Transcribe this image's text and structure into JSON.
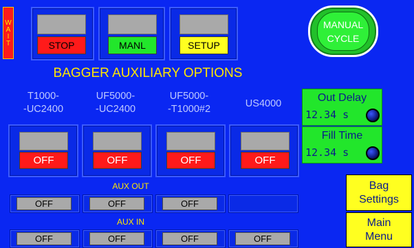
{
  "wait_label": "WAIT",
  "top_buttons": [
    {
      "label": "STOP"
    },
    {
      "label": "MANL"
    },
    {
      "label": "SETUP"
    }
  ],
  "manual_cycle": {
    "line1": "MANUAL",
    "line2": "CYCLE"
  },
  "title": "BAGGER AUXILIARY OPTIONS",
  "columns": [
    {
      "line1": "T1000-",
      "line2": "-UC2400",
      "state": "OFF"
    },
    {
      "line1": "UF5000-",
      "line2": "-UC2400",
      "state": "OFF"
    },
    {
      "line1": "UF5000-",
      "line2": "-T1000#2",
      "state": "OFF"
    },
    {
      "line1": "US4000",
      "line2": "",
      "state": "OFF"
    }
  ],
  "out_delay": {
    "label": "Out Delay",
    "value": "12.34 s"
  },
  "fill_time": {
    "label": "Fill Time",
    "value": "12.34 s"
  },
  "aux_out": {
    "label": "AUX OUT",
    "items": [
      "OFF",
      "OFF",
      "OFF"
    ]
  },
  "aux_in": {
    "label": "AUX IN",
    "items": [
      "OFF",
      "OFF",
      "OFF",
      "OFF"
    ]
  },
  "bag_settings": {
    "line1": "Bag",
    "line2": "Settings"
  },
  "main_menu": {
    "line1": "Main",
    "line2": "Menu"
  },
  "colors": {
    "background": "#0a27f2",
    "stop": "#ff1a1a",
    "manl": "#22e62b",
    "setup": "#ffff20",
    "title": "#ffe600"
  }
}
